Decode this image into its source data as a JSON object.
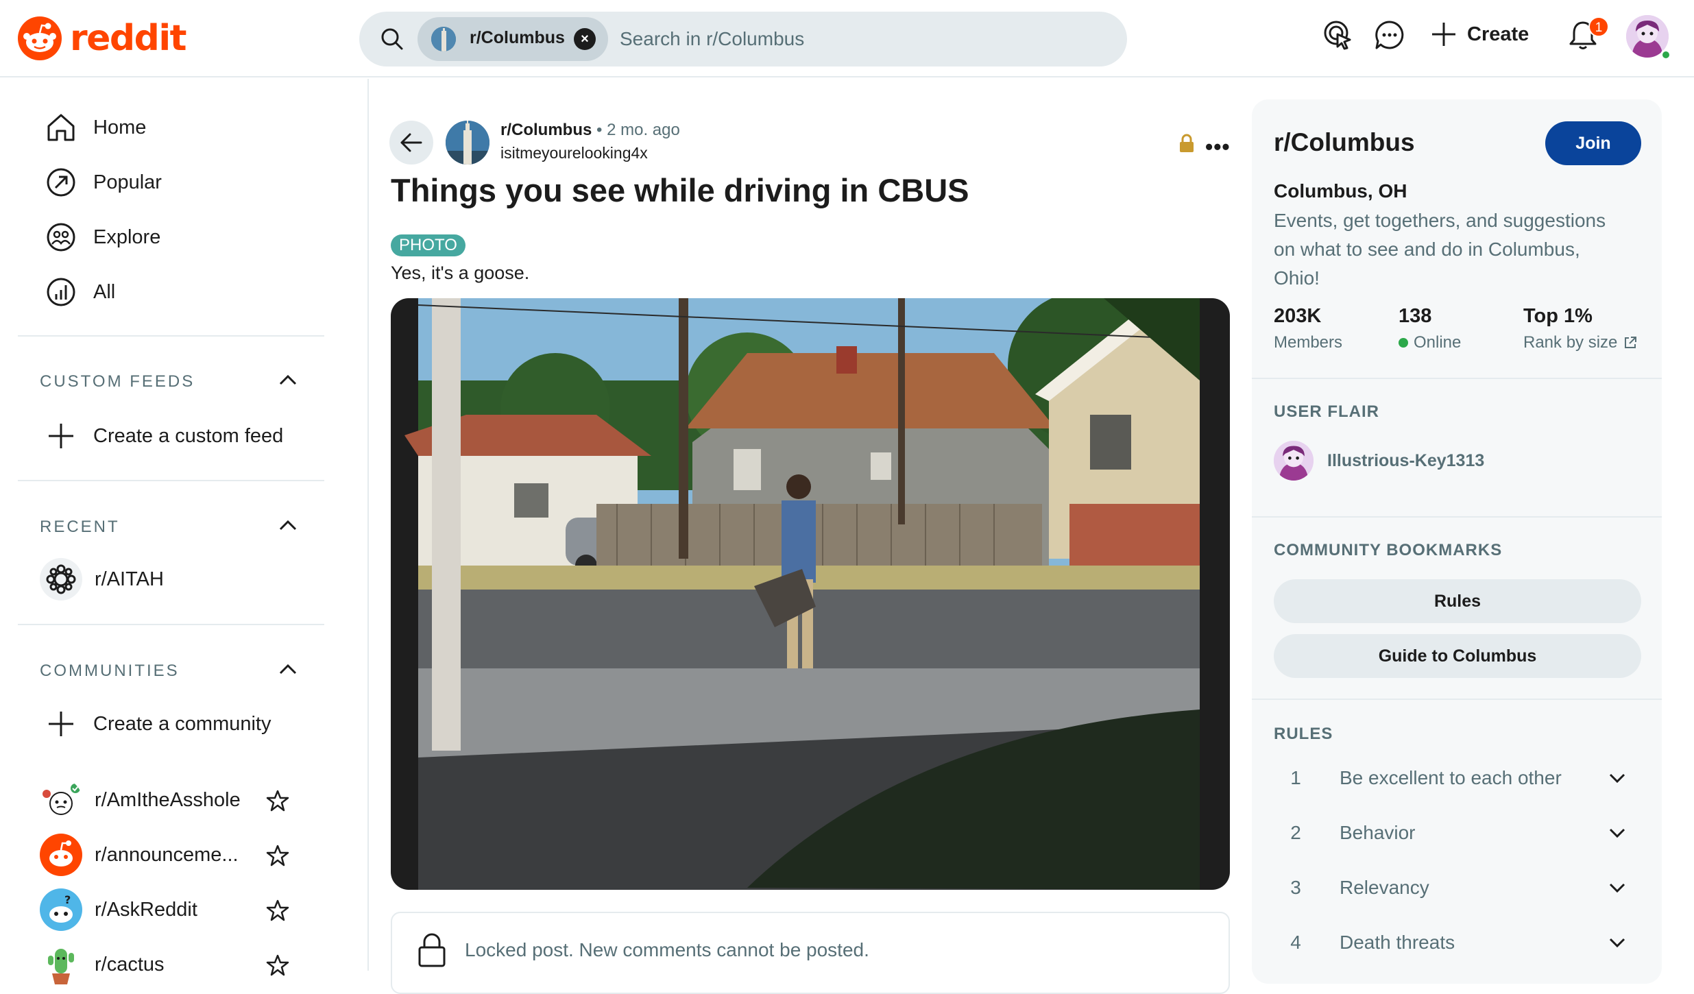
{
  "header": {
    "logo_text": "reddit",
    "search_chip": "r/Columbus",
    "search_placeholder": "Search in r/Columbus",
    "create_label": "Create",
    "notification_count": "1"
  },
  "leftnav": {
    "main": [
      {
        "label": "Home",
        "icon": "home-icon"
      },
      {
        "label": "Popular",
        "icon": "popular-icon"
      },
      {
        "label": "Explore",
        "icon": "explore-icon"
      },
      {
        "label": "All",
        "icon": "all-icon"
      }
    ],
    "custom_feeds": {
      "heading": "CUSTOM FEEDS",
      "create": "Create a custom feed"
    },
    "recent": {
      "heading": "RECENT",
      "items": [
        "r/AITAH"
      ]
    },
    "communities": {
      "heading": "COMMUNITIES",
      "create": "Create a community",
      "items": [
        "r/AmItheAsshole",
        "r/announceme...",
        "r/AskReddit",
        "r/cactus"
      ]
    }
  },
  "post": {
    "subreddit": "r/Columbus",
    "separator": "•",
    "age": "2 mo. ago",
    "author": "isitmeyourelooking4x",
    "title": "Things you see while driving in CBUS",
    "flair": "PHOTO",
    "body": "Yes, it's a goose.",
    "locked_message": "Locked post. New comments cannot be posted."
  },
  "sidebar": {
    "title": "r/Columbus",
    "join": "Join",
    "subtitle": "Columbus, OH",
    "description": "Events, get togethers, and suggestions on what to see and do in Columbus, Ohio!",
    "stats": [
      {
        "value": "203K",
        "label": "Members"
      },
      {
        "value": "138",
        "label": "Online"
      },
      {
        "value": "Top 1%",
        "label": "Rank by size"
      }
    ],
    "user_flair_heading": "USER FLAIR",
    "user_flair_name": "Illustrious-Key1313",
    "bookmarks_heading": "COMMUNITY BOOKMARKS",
    "bookmarks": [
      "Rules",
      "Guide to Columbus"
    ],
    "rules_heading": "RULES",
    "rules": [
      {
        "num": "1",
        "text": "Be excellent to each other"
      },
      {
        "num": "2",
        "text": "Behavior"
      },
      {
        "num": "3",
        "text": "Relevancy"
      },
      {
        "num": "4",
        "text": "Death threats"
      }
    ]
  },
  "colors": {
    "brand": "#ff4500",
    "join": "#0a449b",
    "flair": "#46a8a0",
    "online": "#2ca84a"
  }
}
